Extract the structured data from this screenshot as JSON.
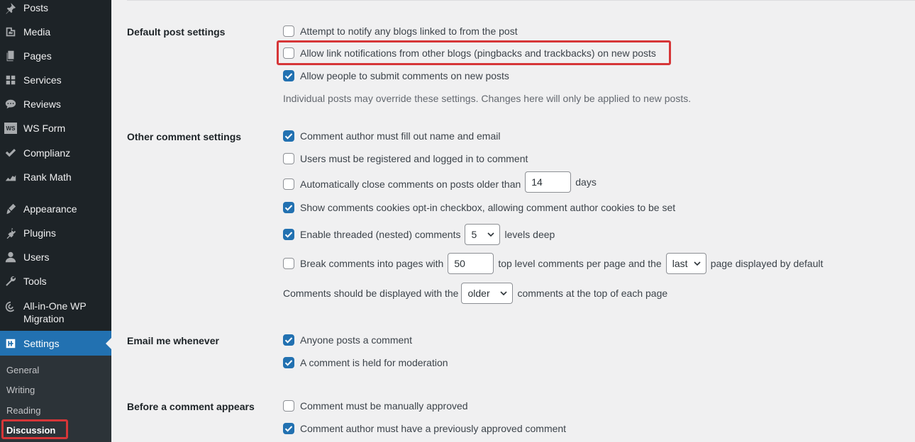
{
  "sidebar": {
    "menu": [
      {
        "label": "Posts",
        "icon": "pin-icon"
      },
      {
        "label": "Media",
        "icon": "media-icon"
      },
      {
        "label": "Pages",
        "icon": "pages-icon"
      },
      {
        "label": "Services",
        "icon": "grid-icon"
      },
      {
        "label": "Reviews",
        "icon": "comment-bubble-icon"
      },
      {
        "label": "WS Form",
        "icon": "ws-form-icon",
        "icon_text": "WS"
      },
      {
        "label": "Complianz",
        "icon": "checkmark-icon"
      },
      {
        "label": "Rank Math",
        "icon": "chart-icon"
      },
      {
        "label": "Appearance",
        "icon": "paintbrush-icon"
      },
      {
        "label": "Plugins",
        "icon": "plugin-icon"
      },
      {
        "label": "Users",
        "icon": "user-icon"
      },
      {
        "label": "Tools",
        "icon": "wrench-icon"
      },
      {
        "label": "All-in-One WP Migration",
        "line1": "All-in-One WP",
        "line2": "Migration",
        "icon": "migration-icon"
      },
      {
        "label": "Settings",
        "icon": "settings-icon",
        "active": true
      }
    ],
    "submenu": [
      {
        "label": "General"
      },
      {
        "label": "Writing"
      },
      {
        "label": "Reading"
      },
      {
        "label": "Discussion",
        "current": true
      }
    ]
  },
  "sections": {
    "default_post": {
      "label": "Default post settings",
      "items": [
        {
          "label": "Attempt to notify any blogs linked to from the post",
          "checked": false
        },
        {
          "label": "Allow link notifications from other blogs (pingbacks and trackbacks) on new posts",
          "checked": false
        },
        {
          "label": "Allow people to submit comments on new posts",
          "checked": true
        }
      ],
      "description": "Individual posts may override these settings. Changes here will only be applied to new posts."
    },
    "other_comment": {
      "label": "Other comment settings",
      "author_fill": {
        "label": "Comment author must fill out name and email",
        "checked": true
      },
      "registered": {
        "label": "Users must be registered and logged in to comment",
        "checked": false
      },
      "auto_close": {
        "label_before": "Automatically close comments on posts older than",
        "value": "14",
        "label_after": "days",
        "checked": false
      },
      "cookies": {
        "label": "Show comments cookies opt-in checkbox, allowing comment author cookies to be set",
        "checked": true
      },
      "threaded": {
        "label_before": "Enable threaded (nested) comments",
        "value": "5",
        "label_after": "levels deep",
        "checked": true
      },
      "paged": {
        "label_before": "Break comments into pages with",
        "value": "50",
        "label_middle": "top level comments per page and the",
        "select_value": "last",
        "label_after": "page displayed by default",
        "checked": false
      },
      "order": {
        "label_before": "Comments should be displayed with the",
        "select_value": "older",
        "label_after": "comments at the top of each page"
      }
    },
    "email": {
      "label": "Email me whenever",
      "items": [
        {
          "label": "Anyone posts a comment",
          "checked": true
        },
        {
          "label": "A comment is held for moderation",
          "checked": true
        }
      ]
    },
    "before": {
      "label": "Before a comment appears",
      "items": [
        {
          "label": "Comment must be manually approved",
          "checked": false
        },
        {
          "label": "Comment author must have a previously approved comment",
          "checked": true
        }
      ]
    }
  },
  "colors": {
    "highlight": "#d63638",
    "accent": "#2271b1",
    "sidebar": "#1d2327"
  }
}
